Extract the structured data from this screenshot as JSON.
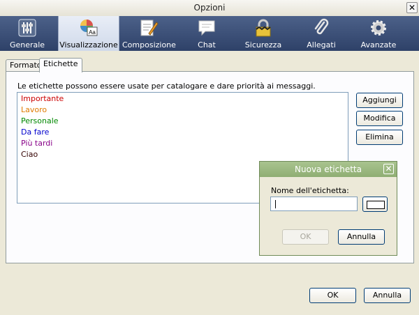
{
  "window": {
    "title": "Opzioni",
    "close_glyph": "✕"
  },
  "toolbar": {
    "items": [
      {
        "label": "Generale",
        "icon": "sliders-icon",
        "active": false
      },
      {
        "label": "Visualizzazione",
        "icon": "display-icon",
        "active": true
      },
      {
        "label": "Composizione",
        "icon": "compose-icon",
        "active": false
      },
      {
        "label": "Chat",
        "icon": "chat-icon",
        "active": false
      },
      {
        "label": "Sicurezza",
        "icon": "lock-icon",
        "active": false
      },
      {
        "label": "Allegati",
        "icon": "paperclip-icon",
        "active": false
      },
      {
        "label": "Avanzate",
        "icon": "gear-icon",
        "active": false
      }
    ]
  },
  "tabs": [
    {
      "label": "Formato",
      "active": false
    },
    {
      "label": "Etichette",
      "active": true
    }
  ],
  "tags": {
    "description": "Le etichette possono essere usate per catalogare e dare priorità ai messaggi.",
    "items": [
      {
        "label": "Importante",
        "color": "#cc0000"
      },
      {
        "label": "Lavoro",
        "color": "#e07a00"
      },
      {
        "label": "Personale",
        "color": "#008800"
      },
      {
        "label": "Da fare",
        "color": "#0000cc"
      },
      {
        "label": "Più tardi",
        "color": "#880088"
      },
      {
        "label": "Ciao",
        "color": "#330000"
      }
    ],
    "buttons": {
      "add": "Aggiungi",
      "edit": "Modifica",
      "delete": "Elimina"
    }
  },
  "dialog": {
    "title": "Nuova etichetta",
    "close_glyph": "✕",
    "name_label": "Nome dell'etichetta:",
    "name_value": "",
    "swatch_color": "#ffffff",
    "ok": "OK",
    "cancel": "Annulla"
  },
  "footer": {
    "ok": "OK",
    "cancel": "Annulla"
  }
}
